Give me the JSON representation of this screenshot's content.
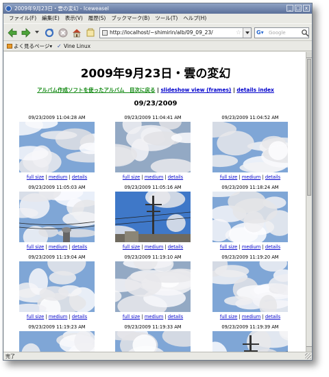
{
  "window": {
    "title": "2009年9月23日・雲の変幻 - Iceweasel",
    "buttons": [
      "_",
      "□",
      "x"
    ]
  },
  "menu": [
    "ファイル(F)",
    "編集(E)",
    "表示(V)",
    "履歴(S)",
    "ブックマーク(B)",
    "ツール(T)",
    "ヘルプ(H)"
  ],
  "toolbar": {
    "url": "http://localhost/~shimirin/alb/09_09_23/",
    "search_placeholder": "Google",
    "search_engine_glyph": "G▾"
  },
  "bookmarks": [
    "よく見るページ▾",
    "Vine Linux"
  ],
  "page": {
    "title": "2009年9月23日・雲の変幻",
    "nav": {
      "back_link": "アルバム作成ソフトを使ったアルバム　目次に戻る",
      "sep": "|",
      "slideshow": "slideshow view (frames)",
      "details": "details index"
    },
    "date": "09/23/2009",
    "link_labels": {
      "full": "full size",
      "medium": "medium",
      "details": "details",
      "sep": "|"
    },
    "photos": [
      {
        "timestamp": "09/23/2009 11:04:28 AM",
        "scene": "clouds-wispy"
      },
      {
        "timestamp": "09/23/2009 11:04:41 AM",
        "scene": "clouds-gray"
      },
      {
        "timestamp": "09/23/2009 11:04:52 AM",
        "scene": "clouds-right"
      },
      {
        "timestamp": "09/23/2009 11:05:03 AM",
        "scene": "clouds-wires"
      },
      {
        "timestamp": "09/23/2009 11:05:16 AM",
        "scene": "pole-blue"
      },
      {
        "timestamp": "09/23/2009 11:18:24 AM",
        "scene": "clouds-puffy"
      },
      {
        "timestamp": "09/23/2009 11:19:04 AM",
        "scene": "clouds-blue"
      },
      {
        "timestamp": "09/23/2009 11:19:10 AM",
        "scene": "clouds-dense"
      },
      {
        "timestamp": "09/23/2009 11:19:20 AM",
        "scene": "clouds-bright"
      },
      {
        "timestamp": "09/23/2009 11:19:23 AM",
        "scene": "clouds-partial"
      },
      {
        "timestamp": "09/23/2009 11:19:33 AM",
        "scene": "clouds-partial"
      },
      {
        "timestamp": "09/23/2009 11:19:39 AM",
        "scene": "pole-partial"
      }
    ]
  },
  "status": "完了",
  "colors": {
    "link": "#0000cc",
    "visited": "#118811",
    "sky": "#7fa6d6"
  }
}
